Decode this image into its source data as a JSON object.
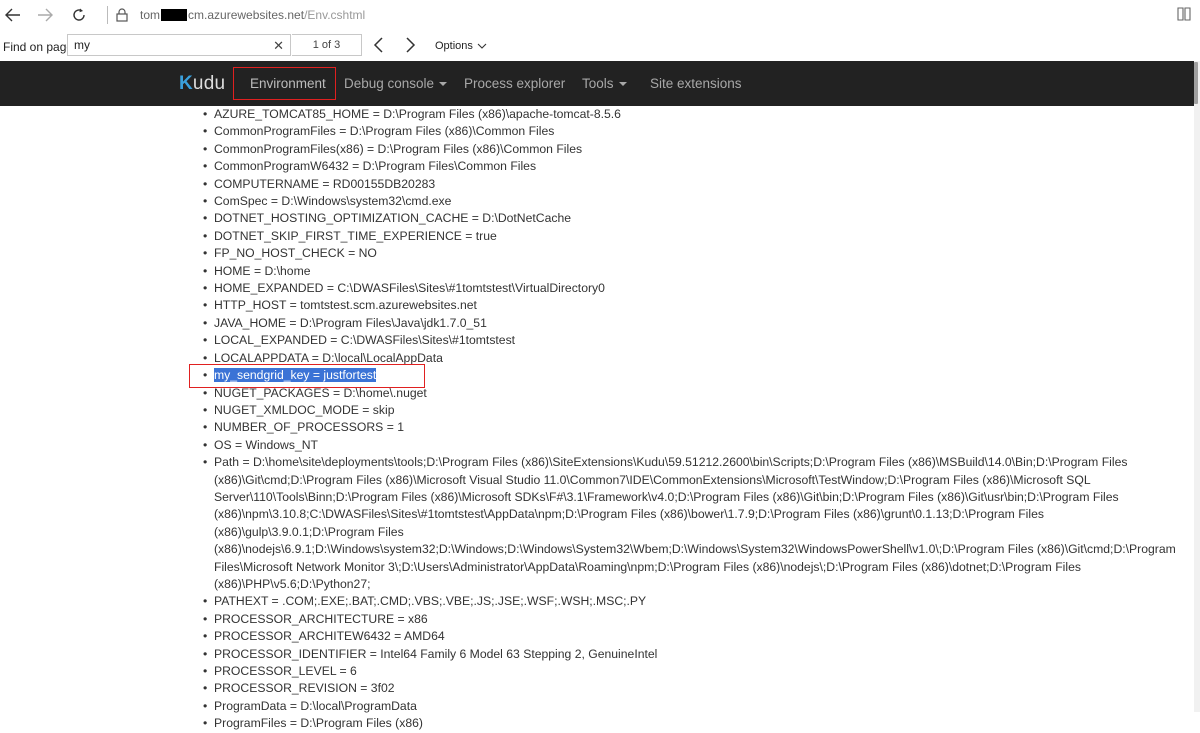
{
  "browser": {
    "url_prefix": "tom",
    "url_domain": "cm.azurewebsites.net",
    "url_path": "/Env.cshtml"
  },
  "find": {
    "label": "Find on page",
    "query": "my",
    "count": "1 of 3",
    "options_label": "Options"
  },
  "nav": {
    "brand_k": "K",
    "brand_rest": "udu",
    "items": [
      {
        "label": "Environment"
      },
      {
        "label": "Debug console"
      },
      {
        "label": "Process explorer"
      },
      {
        "label": "Tools"
      },
      {
        "label": "Site extensions"
      }
    ]
  },
  "env": [
    "AZURE_TOMCAT85_HOME = D:\\Program Files (x86)\\apache-tomcat-8.5.6",
    "CommonProgramFiles = D:\\Program Files (x86)\\Common Files",
    "CommonProgramFiles(x86) = D:\\Program Files (x86)\\Common Files",
    "CommonProgramW6432 = D:\\Program Files\\Common Files",
    "COMPUTERNAME = RD00155DB20283",
    "ComSpec = D:\\Windows\\system32\\cmd.exe",
    "DOTNET_HOSTING_OPTIMIZATION_CACHE = D:\\DotNetCache",
    "DOTNET_SKIP_FIRST_TIME_EXPERIENCE = true",
    "FP_NO_HOST_CHECK = NO",
    "HOME = D:\\home",
    "HOME_EXPANDED = C:\\DWASFiles\\Sites\\#1tomtstest\\VirtualDirectory0",
    "HTTP_HOST = tomtstest.scm.azurewebsites.net",
    "JAVA_HOME = D:\\Program Files\\Java\\jdk1.7.0_51",
    "LOCAL_EXPANDED = C:\\DWASFiles\\Sites\\#1tomtstest",
    "LOCALAPPDATA = D:\\local\\LocalAppData",
    "my_sendgrid_key = justfortest",
    "NUGET_PACKAGES = D:\\home\\.nuget",
    "NUGET_XMLDOC_MODE = skip",
    "NUMBER_OF_PROCESSORS = 1",
    "OS = Windows_NT",
    "Path = D:\\home\\site\\deployments\\tools;D:\\Program Files (x86)\\SiteExtensions\\Kudu\\59.51212.2600\\bin\\Scripts;D:\\Program Files (x86)\\MSBuild\\14.0\\Bin;D:\\Program Files (x86)\\Git\\cmd;D:\\Program Files (x86)\\Microsoft Visual Studio 11.0\\Common7\\IDE\\CommonExtensions\\Microsoft\\TestWindow;D:\\Program Files (x86)\\Microsoft SQL Server\\110\\Tools\\Binn;D:\\Program Files (x86)\\Microsoft SDKs\\F#\\3.1\\Framework\\v4.0;D:\\Program Files (x86)\\Git\\bin;D:\\Program Files (x86)\\Git\\usr\\bin;D:\\Program Files (x86)\\npm\\3.10.8;C:\\DWASFiles\\Sites\\#1tomtstest\\AppData\\npm;D:\\Program Files (x86)\\bower\\1.7.9;D:\\Program Files (x86)\\grunt\\0.1.13;D:\\Program Files (x86)\\gulp\\3.9.0.1;D:\\Program Files (x86)\\nodejs\\6.9.1;D:\\Windows\\system32;D:\\Windows;D:\\Windows\\System32\\Wbem;D:\\Windows\\System32\\WindowsPowerShell\\v1.0\\;D:\\Program Files (x86)\\Git\\cmd;D:\\Program Files\\Microsoft Network Monitor 3\\;D:\\Users\\Administrator\\AppData\\Roaming\\npm;D:\\Program Files (x86)\\nodejs\\;D:\\Program Files (x86)\\dotnet;D:\\Program Files (x86)\\PHP\\v5.6;D:\\Python27;",
    "PATHEXT = .COM;.EXE;.BAT;.CMD;.VBS;.VBE;.JS;.JSE;.WSF;.WSH;.MSC;.PY",
    "PROCESSOR_ARCHITECTURE = x86",
    "PROCESSOR_ARCHITEW6432 = AMD64",
    "PROCESSOR_IDENTIFIER = Intel64 Family 6 Model 63 Stepping 2, GenuineIntel",
    "PROCESSOR_LEVEL = 6",
    "PROCESSOR_REVISION = 3f02",
    "ProgramData = D:\\local\\ProgramData",
    "ProgramFiles = D:\\Program Files (x86)"
  ],
  "colors": {
    "nav_bg": "#222222",
    "highlight": "#3b73d6",
    "annotation_red": "#e02020",
    "brand_accent": "#3aa0dc"
  }
}
